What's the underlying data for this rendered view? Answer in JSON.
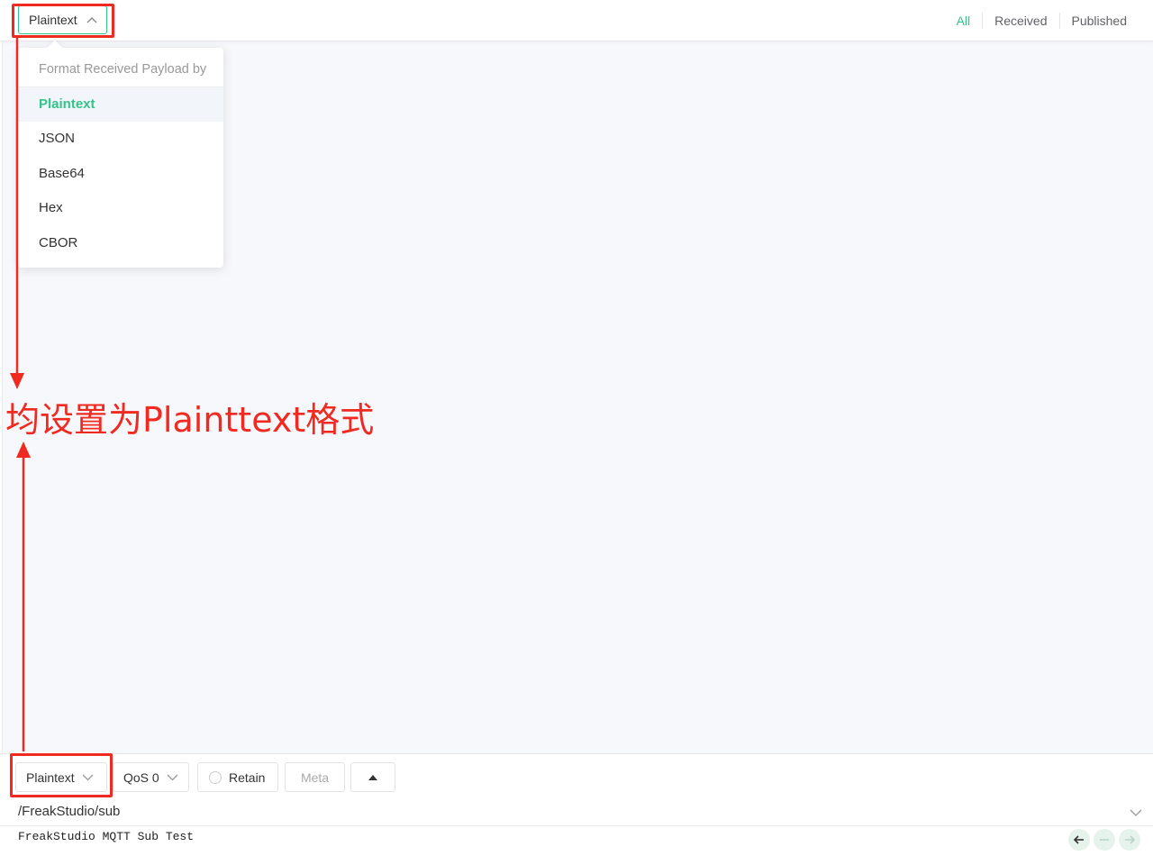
{
  "header": {
    "format_select_value": "Plaintext",
    "tabs": [
      {
        "label": "All",
        "active": true
      },
      {
        "label": "Received",
        "active": false
      },
      {
        "label": "Published",
        "active": false
      }
    ]
  },
  "dropdown": {
    "header": "Format Received Payload by",
    "items": [
      {
        "label": "Plaintext",
        "selected": true
      },
      {
        "label": "JSON"
      },
      {
        "label": "Base64"
      },
      {
        "label": "Hex"
      },
      {
        "label": "CBOR"
      }
    ]
  },
  "annotation": {
    "text": "均设置为Plainttext格式",
    "color": "#f02a20"
  },
  "publish": {
    "format_value": "Plaintext",
    "qos_value": "QoS 0",
    "retain_label": "Retain",
    "meta_label": "Meta",
    "topic": "/FreakStudio/sub",
    "payload": "FreakStudio MQTT Sub Test"
  },
  "icons": {
    "format_chevron": "chevron-up-icon",
    "bottom_chevrons": "chevron-down-icon",
    "expand": "caret-up-icon",
    "history": [
      "arrow-left-icon",
      "minus-icon",
      "arrow-right-icon"
    ]
  },
  "colors": {
    "accent": "#34c388",
    "annotation": "#f02a20",
    "background": "#f7f8fc"
  }
}
